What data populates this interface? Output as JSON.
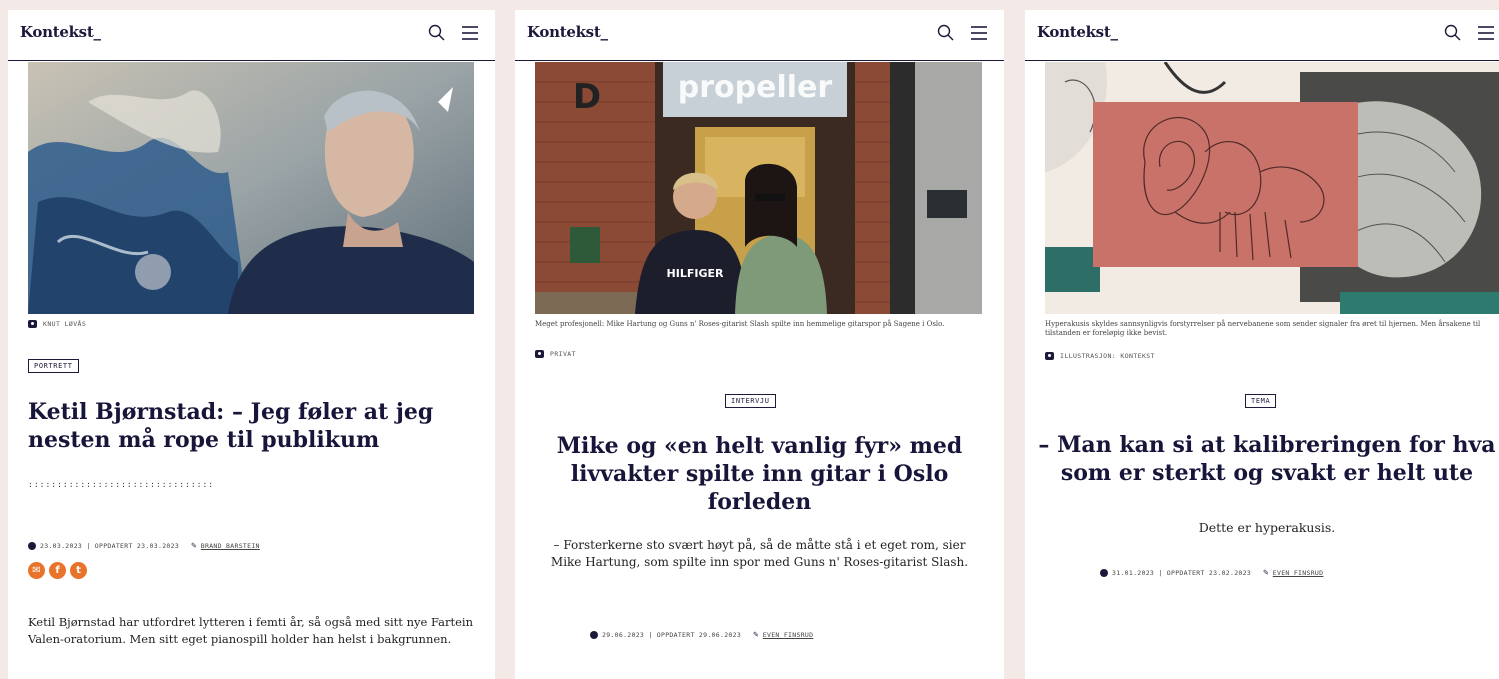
{
  "logo": "Kontekst_",
  "articles": [
    {
      "photo_credit": "KNUT LØVÅS",
      "tag": "PORTRETT",
      "headline": "Ketil Bjørnstad: – Jeg føler at jeg nesten må rope til publikum",
      "dots": "::::::::::::::::::::::::::::::::",
      "date": "23.03.2023",
      "updated": "OPPDATERT 23.03.2023",
      "author": "BRAND BARSTEIN",
      "lead": "Ketil Bjørnstad har utfordret lytteren i femti år, så også med sitt nye Fartein Valen-oratorium. Men sitt eget pianospill holder han helst i bakgrunnen."
    },
    {
      "caption": "Meget profesjonell: Mike Hartung og Guns n' Roses-gitarist Slash spilte inn hemmelige gitarspor på Sagene i Oslo.",
      "photo_credit": "PRIVAT",
      "sign_door": "propeller",
      "sign_d": "D",
      "tshirt": "HILFIGER",
      "tag": "INTERVJU",
      "headline": "Mike og «en helt vanlig fyr» med livvakter spilte inn gitar i Oslo forleden",
      "lead": "– Forsterkerne sto svært høyt på, så de måtte stå i et eget rom, sier Mike Hartung, som spilte inn spor med Guns n' Roses-gitarist Slash.",
      "date": "29.06.2023",
      "updated": "OPPDATERT 29.06.2023",
      "author": "EVEN FINSRUD"
    },
    {
      "caption": "Hyperakusis skyldes sannsynligvis forstyrrelser på nervebanene som sender signaler fra øret til hjernen. Men årsakene til tilstanden er foreløpig ikke bevist.",
      "photo_credit": "ILLUSTRASJON: KONTEKST",
      "tag": "TEMA",
      "headline": "– Man kan si at kalibreringen for hva som er sterkt og svakt er helt ute",
      "lead": "Dette er hyperakusis.",
      "date": "31.01.2023",
      "updated": "OPPDATERT 23.02.2023",
      "author": "EVEN FINSRUD"
    }
  ],
  "colors": {
    "ink": "#1c1a3a",
    "page_bg": "#f3e9e6",
    "share": "#e8732b",
    "ear_panel": "#c9726a"
  },
  "icons": [
    "search-icon",
    "menu-icon",
    "camera-icon",
    "clock-icon",
    "pen-icon",
    "email-icon",
    "facebook-icon",
    "twitter-icon"
  ]
}
